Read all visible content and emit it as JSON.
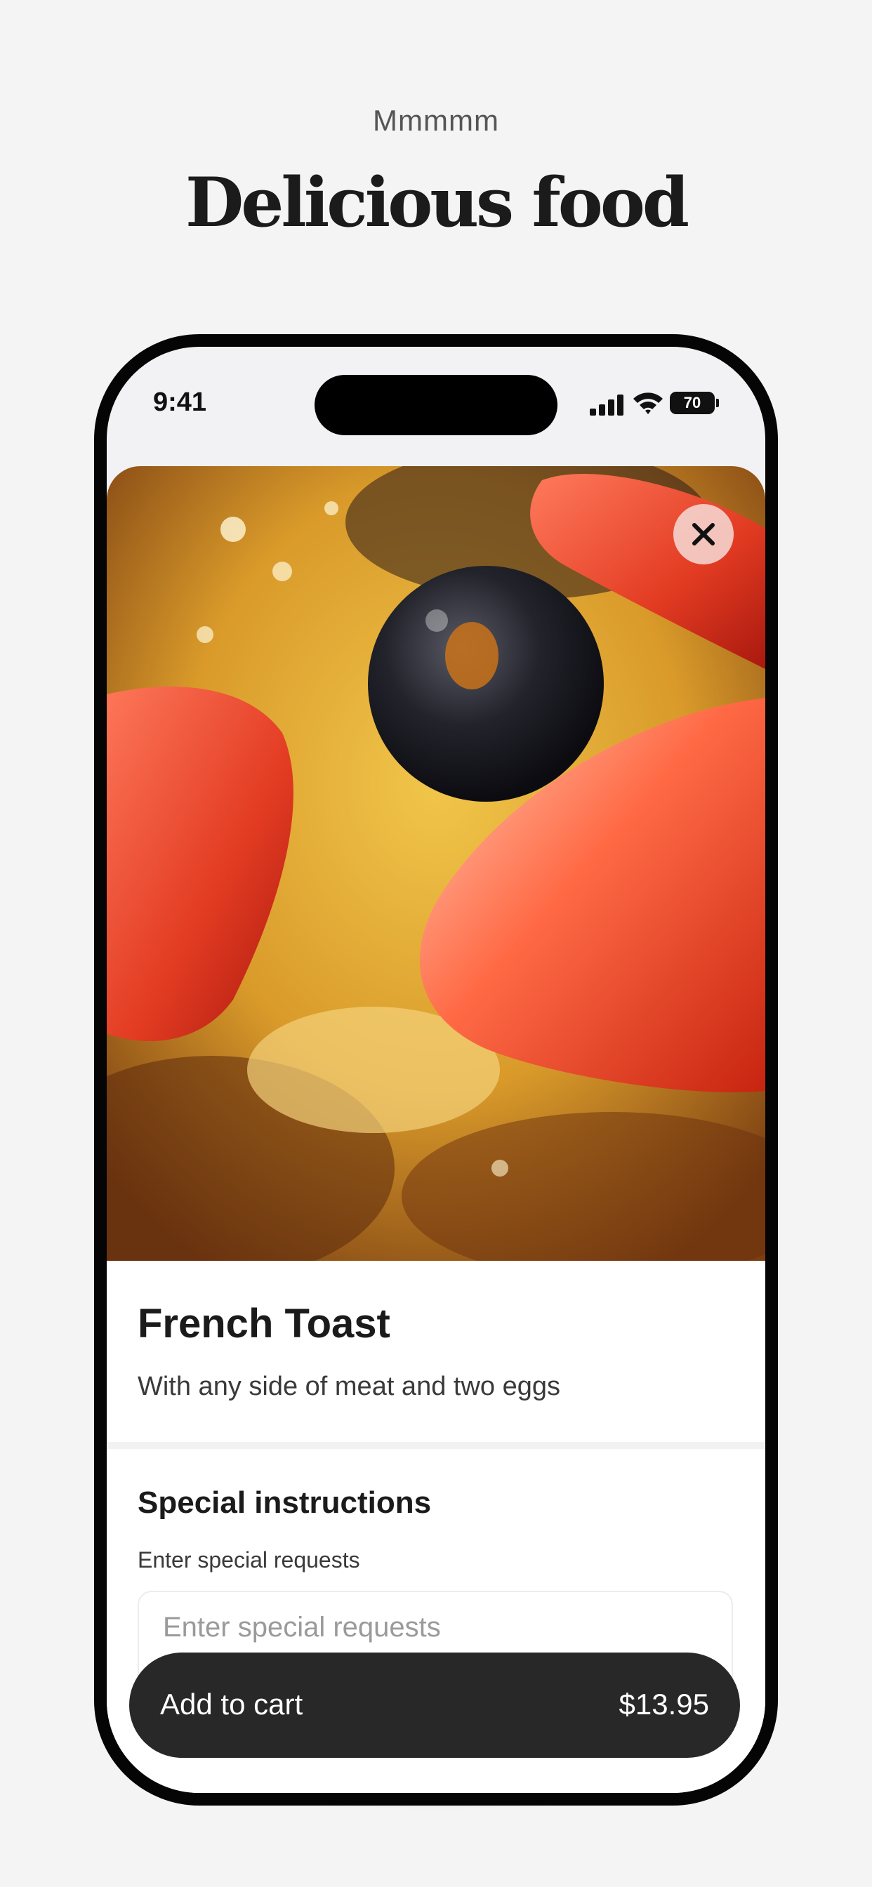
{
  "promo": {
    "eyebrow": "Mmmmm",
    "headline": "Delicious food"
  },
  "status_bar": {
    "time": "9:41",
    "battery": "70",
    "icons": [
      "cellular-signal-icon",
      "wifi-icon",
      "battery-icon"
    ]
  },
  "item": {
    "image": "french-toast-photo",
    "title": "French Toast",
    "description": "With any side of meat and two eggs",
    "close_icon": "close-icon"
  },
  "special_instructions": {
    "title": "Special instructions",
    "helper": "Enter special requests",
    "placeholder": "Enter special requests"
  },
  "cart": {
    "label": "Add to cart",
    "price": "$13.95"
  },
  "colors": {
    "page_background": "#f4f4f4",
    "phone_frame": "#050505",
    "cart_button": "#282828",
    "text_primary": "#1b1b1b"
  }
}
